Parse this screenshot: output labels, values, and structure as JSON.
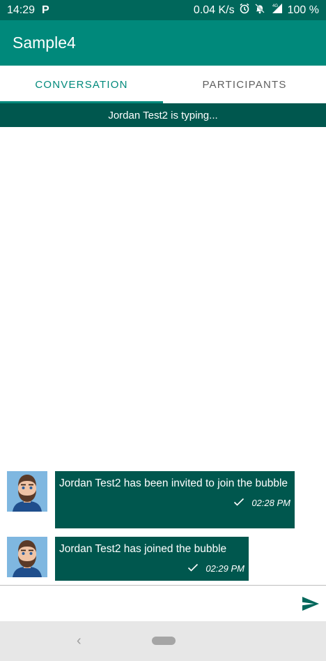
{
  "status_bar": {
    "time": "14:29",
    "app_badge": "P",
    "network_speed": "0.04 K/s",
    "battery": "100 %",
    "icons": [
      "alarm-icon",
      "notifications-off-icon",
      "signal-4g-icon"
    ]
  },
  "app_bar": {
    "title": "Sample4"
  },
  "tabs": [
    {
      "label": "CONVERSATION",
      "active": true
    },
    {
      "label": "PARTICIPANTS",
      "active": false
    }
  ],
  "typing_indicator": "Jordan Test2 is typing...",
  "messages": [
    {
      "text": "Jordan Test2 has been invited to join the bubble",
      "time": "02:28 PM"
    },
    {
      "text": "Jordan Test2 has joined the bubble",
      "time": "02:29 PM"
    }
  ],
  "composer": {
    "placeholder": ""
  },
  "colors": {
    "status_bar": "#00675b",
    "app_bar": "#00897b",
    "accent": "#00897b",
    "bubble": "#00574e"
  }
}
